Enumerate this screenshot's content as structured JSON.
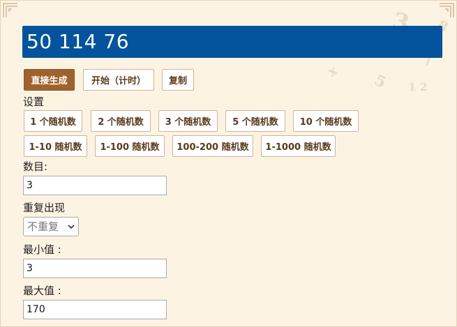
{
  "display": {
    "value": "50 114 76"
  },
  "actions": {
    "generate": "直接生成",
    "start": "开始（计时）",
    "copy": "复制"
  },
  "settings": {
    "heading": "设置",
    "presets": [
      "1 个随机数",
      "2 个随机数",
      "3 个随机数",
      "5 个随机数",
      "10 个随机数"
    ],
    "ranges": [
      "1-10 随机数",
      "1-100 随机数",
      "100-200 随机数",
      "1-1000 随机数"
    ]
  },
  "form": {
    "count_label": "数目:",
    "count_value": "3",
    "repeat_label": "重复出现",
    "repeat_selected": "不重复",
    "min_label": "最小值   :",
    "min_value": "3",
    "max_label": "最大值   :",
    "max_value": "170"
  },
  "colors": {
    "display_bg": "#03549c",
    "primary_btn": "#a0622c",
    "page_bg": "#fdf3e3"
  }
}
